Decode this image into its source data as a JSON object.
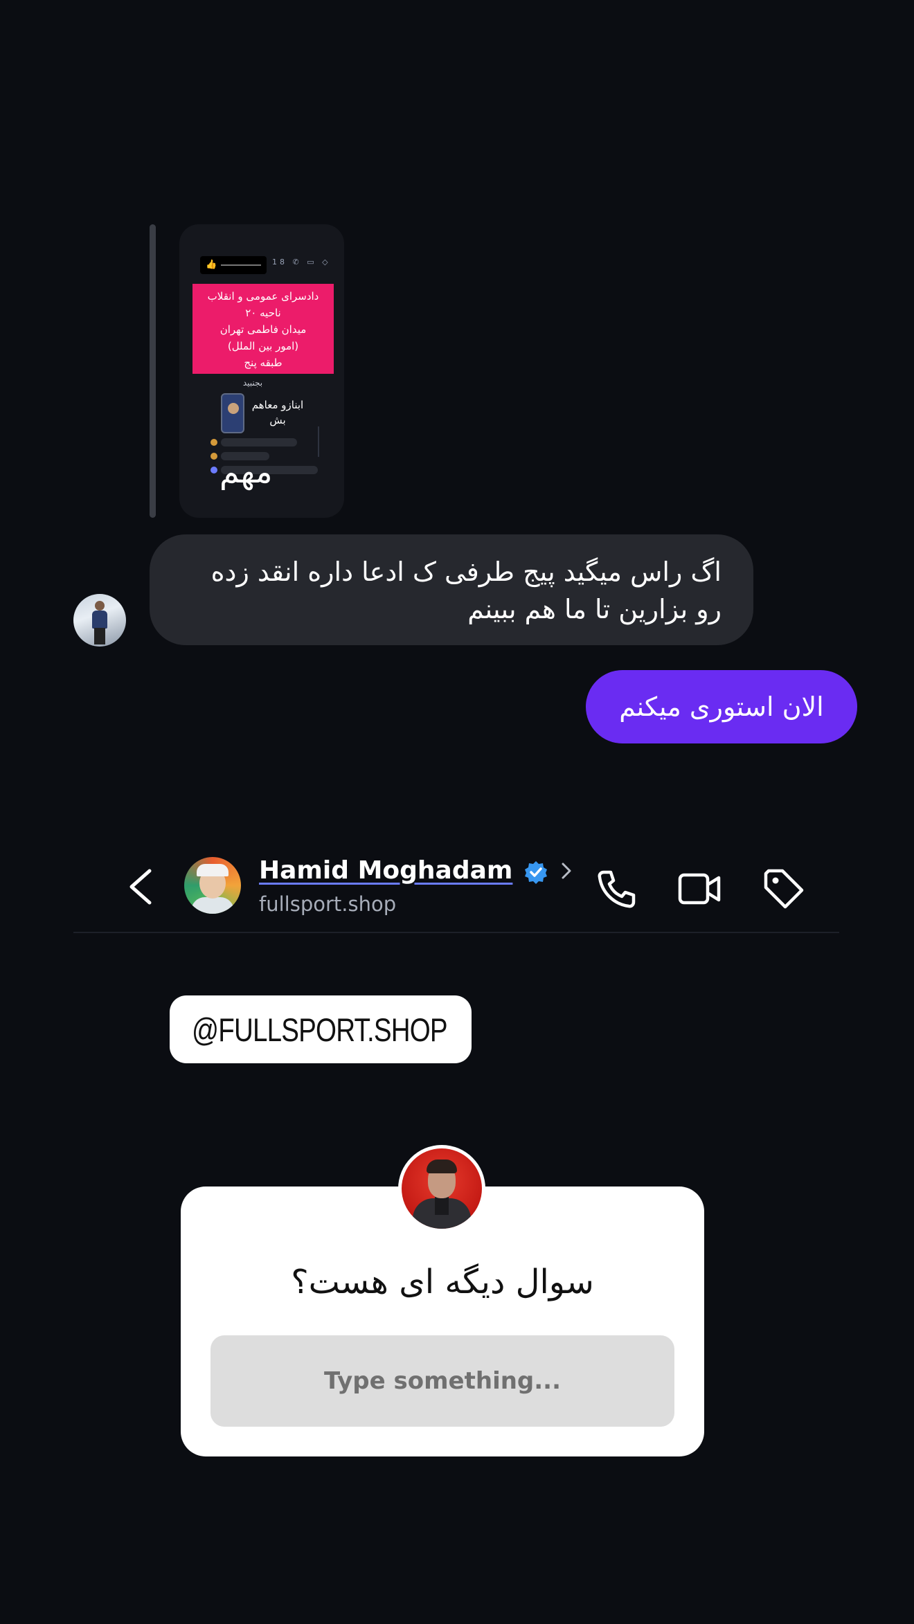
{
  "replied_story": {
    "card_lines": [
      "دادسرای عمومی و انقلاب",
      "ناحیه ۲۰",
      "میدان فاطمی تهران",
      "(امور بین الملل)",
      "طبقه پنج"
    ],
    "caption_top": "بجنبید",
    "script_text": "ابنازو معاهم بش",
    "big_text": "مهم"
  },
  "messages": {
    "incoming_text": "اگ راس میگید پیج طرفی ک ادعا داره انقد زده رو بزارین تا ما هم ببینم",
    "outgoing_text": "الان استوری میکنم"
  },
  "chat_header": {
    "name": "Hamid Moghadam",
    "username": "fullsport.shop",
    "icons": [
      "back-chevron",
      "verified-badge",
      "chevron-right",
      "phone",
      "video-camera",
      "tag"
    ]
  },
  "mention_sticker": {
    "handle": "@FULLSPORT.SHOP",
    "icon": "instagram-logo"
  },
  "question_sticker": {
    "question": "سوال دیگه ای هست؟",
    "placeholder": "Type something..."
  },
  "colors": {
    "background": "#0b0d12",
    "incoming_bubble": "#26282e",
    "outgoing_bubble": "#6a2cf2",
    "story_card_pink": "#ec1c6a",
    "verified_blue": "#3897f0"
  }
}
